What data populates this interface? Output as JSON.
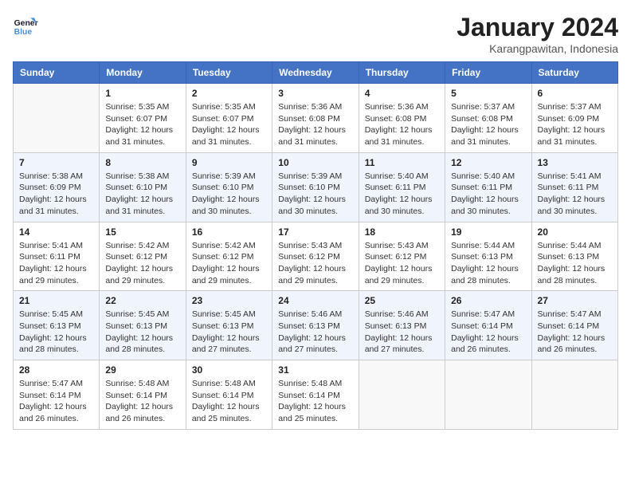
{
  "logo": {
    "line1": "General",
    "line2": "Blue"
  },
  "title": "January 2024",
  "location": "Karangpawitan, Indonesia",
  "days_of_week": [
    "Sunday",
    "Monday",
    "Tuesday",
    "Wednesday",
    "Thursday",
    "Friday",
    "Saturday"
  ],
  "weeks": [
    {
      "shaded": false,
      "days": [
        {
          "num": "",
          "empty": true
        },
        {
          "num": "1",
          "sunrise": "5:35 AM",
          "sunset": "6:07 PM",
          "daylight": "12 hours and 31 minutes."
        },
        {
          "num": "2",
          "sunrise": "5:35 AM",
          "sunset": "6:07 PM",
          "daylight": "12 hours and 31 minutes."
        },
        {
          "num": "3",
          "sunrise": "5:36 AM",
          "sunset": "6:08 PM",
          "daylight": "12 hours and 31 minutes."
        },
        {
          "num": "4",
          "sunrise": "5:36 AM",
          "sunset": "6:08 PM",
          "daylight": "12 hours and 31 minutes."
        },
        {
          "num": "5",
          "sunrise": "5:37 AM",
          "sunset": "6:08 PM",
          "daylight": "12 hours and 31 minutes."
        },
        {
          "num": "6",
          "sunrise": "5:37 AM",
          "sunset": "6:09 PM",
          "daylight": "12 hours and 31 minutes."
        }
      ]
    },
    {
      "shaded": true,
      "days": [
        {
          "num": "7",
          "sunrise": "5:38 AM",
          "sunset": "6:09 PM",
          "daylight": "12 hours and 31 minutes."
        },
        {
          "num": "8",
          "sunrise": "5:38 AM",
          "sunset": "6:10 PM",
          "daylight": "12 hours and 31 minutes."
        },
        {
          "num": "9",
          "sunrise": "5:39 AM",
          "sunset": "6:10 PM",
          "daylight": "12 hours and 30 minutes."
        },
        {
          "num": "10",
          "sunrise": "5:39 AM",
          "sunset": "6:10 PM",
          "daylight": "12 hours and 30 minutes."
        },
        {
          "num": "11",
          "sunrise": "5:40 AM",
          "sunset": "6:11 PM",
          "daylight": "12 hours and 30 minutes."
        },
        {
          "num": "12",
          "sunrise": "5:40 AM",
          "sunset": "6:11 PM",
          "daylight": "12 hours and 30 minutes."
        },
        {
          "num": "13",
          "sunrise": "5:41 AM",
          "sunset": "6:11 PM",
          "daylight": "12 hours and 30 minutes."
        }
      ]
    },
    {
      "shaded": false,
      "days": [
        {
          "num": "14",
          "sunrise": "5:41 AM",
          "sunset": "6:11 PM",
          "daylight": "12 hours and 29 minutes."
        },
        {
          "num": "15",
          "sunrise": "5:42 AM",
          "sunset": "6:12 PM",
          "daylight": "12 hours and 29 minutes."
        },
        {
          "num": "16",
          "sunrise": "5:42 AM",
          "sunset": "6:12 PM",
          "daylight": "12 hours and 29 minutes."
        },
        {
          "num": "17",
          "sunrise": "5:43 AM",
          "sunset": "6:12 PM",
          "daylight": "12 hours and 29 minutes."
        },
        {
          "num": "18",
          "sunrise": "5:43 AM",
          "sunset": "6:12 PM",
          "daylight": "12 hours and 29 minutes."
        },
        {
          "num": "19",
          "sunrise": "5:44 AM",
          "sunset": "6:13 PM",
          "daylight": "12 hours and 28 minutes."
        },
        {
          "num": "20",
          "sunrise": "5:44 AM",
          "sunset": "6:13 PM",
          "daylight": "12 hours and 28 minutes."
        }
      ]
    },
    {
      "shaded": true,
      "days": [
        {
          "num": "21",
          "sunrise": "5:45 AM",
          "sunset": "6:13 PM",
          "daylight": "12 hours and 28 minutes."
        },
        {
          "num": "22",
          "sunrise": "5:45 AM",
          "sunset": "6:13 PM",
          "daylight": "12 hours and 28 minutes."
        },
        {
          "num": "23",
          "sunrise": "5:45 AM",
          "sunset": "6:13 PM",
          "daylight": "12 hours and 27 minutes."
        },
        {
          "num": "24",
          "sunrise": "5:46 AM",
          "sunset": "6:13 PM",
          "daylight": "12 hours and 27 minutes."
        },
        {
          "num": "25",
          "sunrise": "5:46 AM",
          "sunset": "6:13 PM",
          "daylight": "12 hours and 27 minutes."
        },
        {
          "num": "26",
          "sunrise": "5:47 AM",
          "sunset": "6:14 PM",
          "daylight": "12 hours and 26 minutes."
        },
        {
          "num": "27",
          "sunrise": "5:47 AM",
          "sunset": "6:14 PM",
          "daylight": "12 hours and 26 minutes."
        }
      ]
    },
    {
      "shaded": false,
      "days": [
        {
          "num": "28",
          "sunrise": "5:47 AM",
          "sunset": "6:14 PM",
          "daylight": "12 hours and 26 minutes."
        },
        {
          "num": "29",
          "sunrise": "5:48 AM",
          "sunset": "6:14 PM",
          "daylight": "12 hours and 26 minutes."
        },
        {
          "num": "30",
          "sunrise": "5:48 AM",
          "sunset": "6:14 PM",
          "daylight": "12 hours and 25 minutes."
        },
        {
          "num": "31",
          "sunrise": "5:48 AM",
          "sunset": "6:14 PM",
          "daylight": "12 hours and 25 minutes."
        },
        {
          "num": "",
          "empty": true
        },
        {
          "num": "",
          "empty": true
        },
        {
          "num": "",
          "empty": true
        }
      ]
    }
  ]
}
